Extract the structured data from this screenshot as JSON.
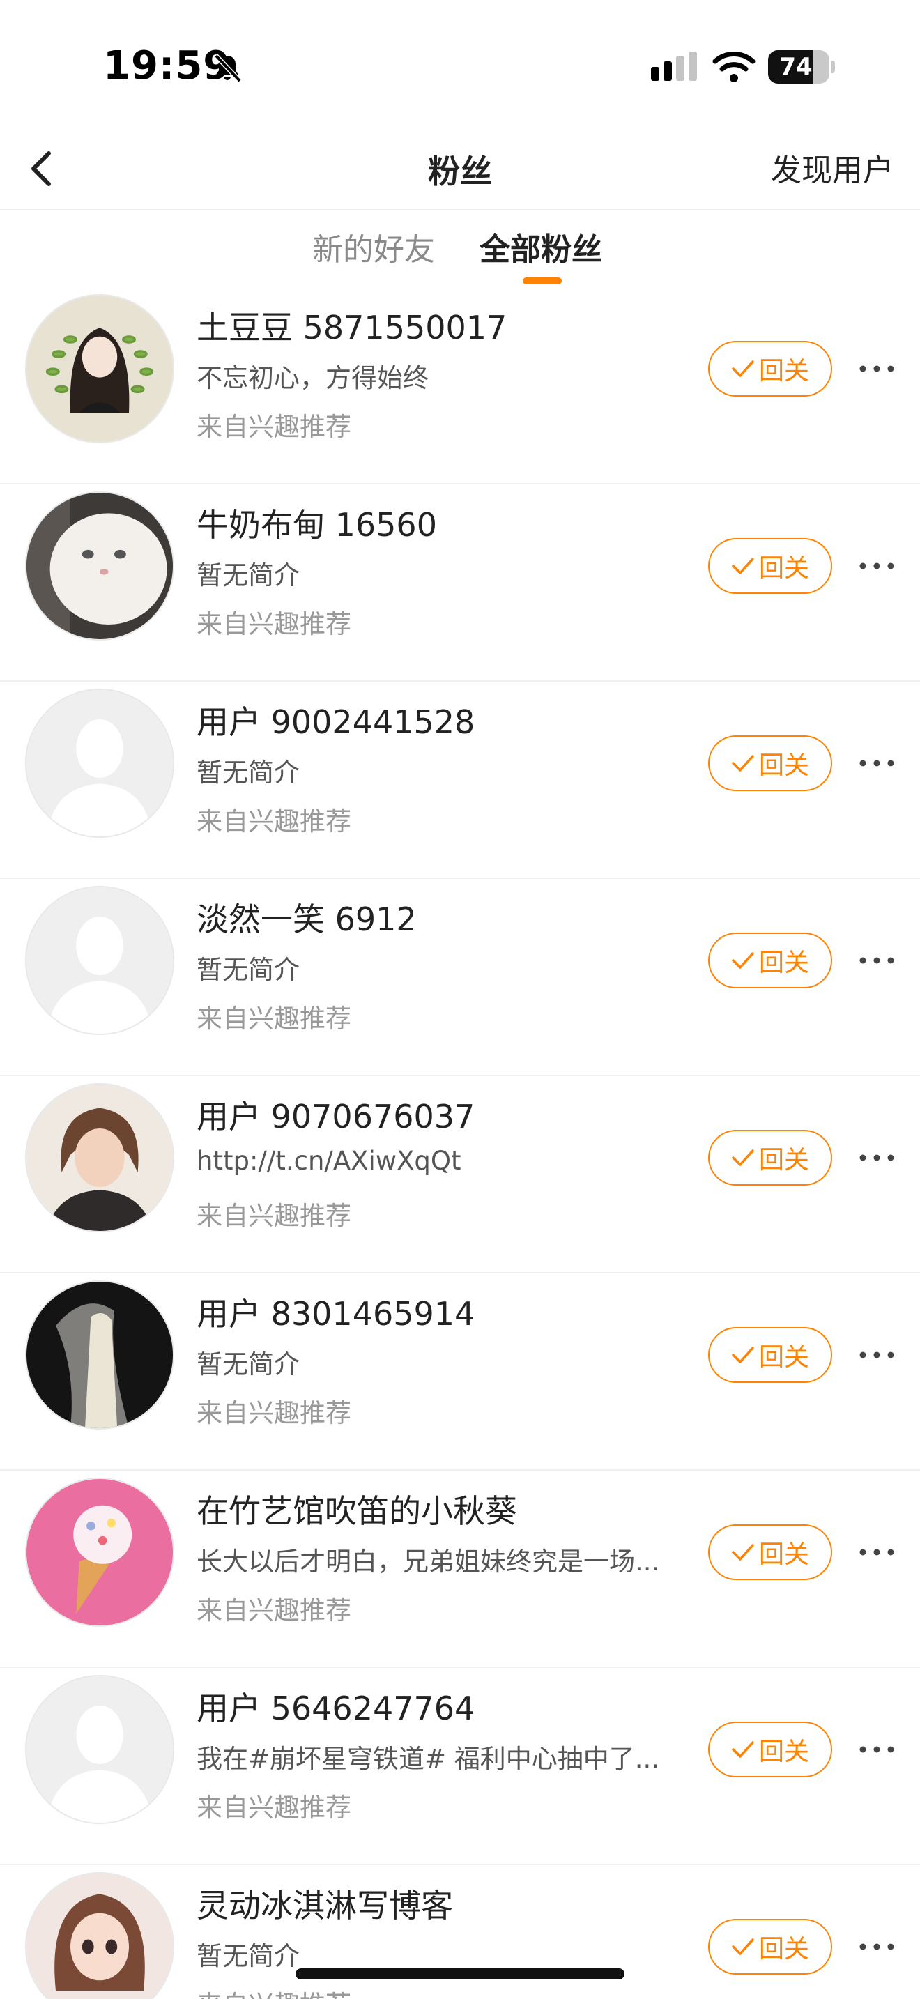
{
  "status_bar": {
    "time": "19:59",
    "battery_percent": "74",
    "icons": [
      "bell-slash-icon",
      "signal-icon",
      "wifi-icon",
      "battery-icon"
    ]
  },
  "nav": {
    "title": "粉丝",
    "right_action": "发现用户",
    "back_icon": "chevron-left-icon"
  },
  "tabs": [
    {
      "label": "新的好友",
      "active": false
    },
    {
      "label": "全部粉丝",
      "active": true
    }
  ],
  "colors": {
    "accent": "#ff8200",
    "text_primary": "#222222",
    "text_secondary": "#555555",
    "text_muted": "#999999"
  },
  "follow_label": "回关",
  "fans": [
    {
      "name": "土豆豆 5871550017",
      "bio": "不忘初心，方得始终",
      "source": "来自兴趣推荐",
      "avatar": "girl-illustration-avatar"
    },
    {
      "name": "牛奶布甸 16560",
      "bio": "暂无简介",
      "source": "来自兴趣推荐",
      "avatar": "white-cat-avatar"
    },
    {
      "name": "用户 9002441528",
      "bio": "暂无简介",
      "source": "来自兴趣推荐",
      "avatar": "default-avatar"
    },
    {
      "name": "淡然一笑 6912",
      "bio": "暂无简介",
      "source": "来自兴趣推荐",
      "avatar": "default-avatar"
    },
    {
      "name": "用户 9070676037",
      "bio": "http://t.cn/AXiwXqQt",
      "source": "来自兴趣推荐",
      "avatar": "anime-boy-avatar"
    },
    {
      "name": "用户 8301465914",
      "bio": "暂无简介",
      "source": "来自兴趣推荐",
      "avatar": "bride-veil-avatar"
    },
    {
      "name": "在竹艺馆吹笛的小秋葵",
      "bio": "长大以后才明白，兄弟姐妹终究是一场...",
      "source": "来自兴趣推荐",
      "avatar": "ice-cream-avatar"
    },
    {
      "name": "用户 5646247764",
      "bio": "我在#崩坏星穹铁道# 福利中心抽中了...",
      "source": "来自兴趣推荐",
      "avatar": "default-avatar"
    },
    {
      "name": "灵动冰淇淋写博客",
      "bio": "暂无简介",
      "source": "来自兴趣推荐",
      "avatar": "cartoon-girl-avatar"
    }
  ]
}
